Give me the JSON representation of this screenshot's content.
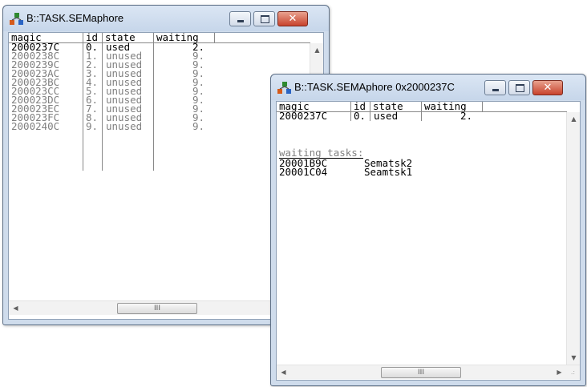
{
  "window1": {
    "title": "B::TASK.SEMaphore",
    "columns": [
      "magic",
      "id",
      "state",
      "waiting"
    ],
    "rows": [
      {
        "magic": "2000237C",
        "id": "0.",
        "state": "used",
        "waiting": "2."
      },
      {
        "magic": "2000238C",
        "id": "1.",
        "state": "unused",
        "waiting": "9."
      },
      {
        "magic": "2000239C",
        "id": "2.",
        "state": "unused",
        "waiting": "9."
      },
      {
        "magic": "200023AC",
        "id": "3.",
        "state": "unused",
        "waiting": "9."
      },
      {
        "magic": "200023BC",
        "id": "4.",
        "state": "unused",
        "waiting": "9."
      },
      {
        "magic": "200023CC",
        "id": "5.",
        "state": "unused",
        "waiting": "9."
      },
      {
        "magic": "200023DC",
        "id": "6.",
        "state": "unused",
        "waiting": "9."
      },
      {
        "magic": "200023EC",
        "id": "7.",
        "state": "unused",
        "waiting": "9."
      },
      {
        "magic": "200023FC",
        "id": "8.",
        "state": "unused",
        "waiting": "9."
      },
      {
        "magic": "2000240C",
        "id": "9.",
        "state": "unused",
        "waiting": "9."
      }
    ],
    "scroll_left": "◀",
    "scroll_up": "▲",
    "thumb_grip": "III"
  },
  "window2": {
    "title": "B::TASK.SEMAphore 0x2000237C",
    "columns": [
      "magic",
      "id",
      "state",
      "waiting"
    ],
    "row": {
      "magic": "2000237C",
      "id": "0.",
      "state": "used",
      "waiting": "2."
    },
    "waiting_label": "waiting tasks:",
    "tasks": [
      {
        "addr": "20001B9C",
        "name": "Sematsk2"
      },
      {
        "addr": "20001C04",
        "name": "Seamtsk1"
      }
    ],
    "scroll_left": "◀",
    "scroll_right": "▶",
    "scroll_up": "▲",
    "scroll_down": "▼",
    "thumb_grip": "III",
    "size_grip": ".:"
  },
  "icons": {
    "app": "trace32-app-icon",
    "minimize": "minimize-icon",
    "maximize": "maximize-icon",
    "close": "close-icon"
  },
  "colors": {
    "used_text": "#000000",
    "unused_text": "#808080",
    "close_button": "#c8432d",
    "titlebar": "#cfdcec"
  }
}
